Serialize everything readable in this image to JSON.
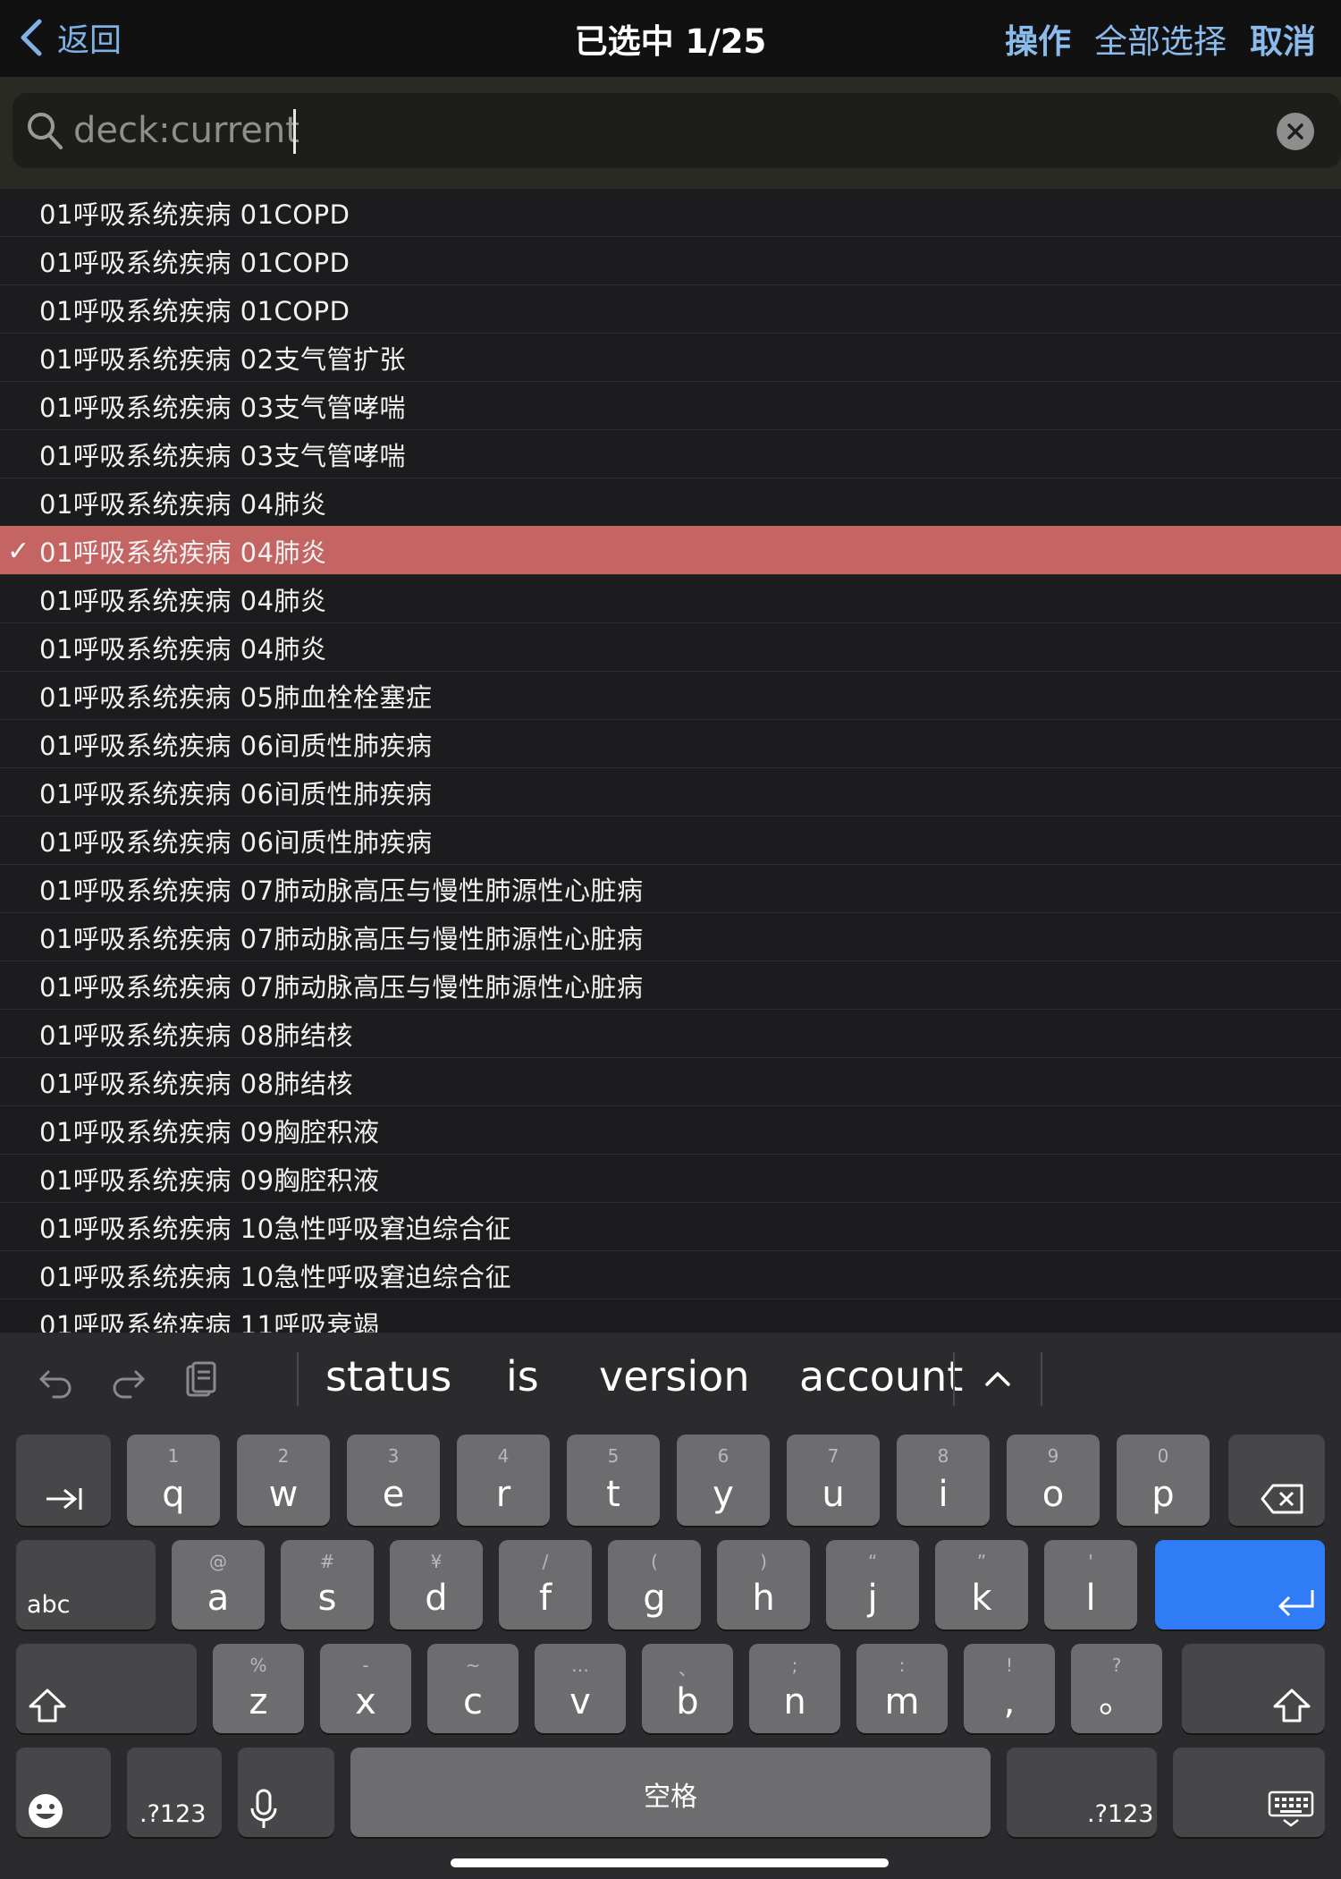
{
  "nav": {
    "back_label": "返回",
    "title": "已选中 1/25",
    "actions_label": "操作",
    "select_all_label": "全部选择",
    "cancel_label": "取消"
  },
  "search": {
    "value": "deck:current"
  },
  "list": {
    "rows": [
      {
        "text": "01呼吸系统疾病 01COPD",
        "selected": false
      },
      {
        "text": "01呼吸系统疾病 01COPD",
        "selected": false
      },
      {
        "text": "01呼吸系统疾病 01COPD",
        "selected": false
      },
      {
        "text": "01呼吸系统疾病 02支气管扩张",
        "selected": false
      },
      {
        "text": "01呼吸系统疾病 03支气管哮喘",
        "selected": false
      },
      {
        "text": "01呼吸系统疾病 03支气管哮喘",
        "selected": false
      },
      {
        "text": "01呼吸系统疾病 04肺炎",
        "selected": false
      },
      {
        "text": "01呼吸系统疾病 04肺炎",
        "selected": true
      },
      {
        "text": "01呼吸系统疾病 04肺炎",
        "selected": false
      },
      {
        "text": "01呼吸系统疾病 04肺炎",
        "selected": false
      },
      {
        "text": "01呼吸系统疾病 05肺血栓栓塞症",
        "selected": false
      },
      {
        "text": "01呼吸系统疾病 06间质性肺疾病",
        "selected": false
      },
      {
        "text": "01呼吸系统疾病 06间质性肺疾病",
        "selected": false
      },
      {
        "text": "01呼吸系统疾病 06间质性肺疾病",
        "selected": false
      },
      {
        "text": "01呼吸系统疾病 07肺动脉高压与慢性肺源性心脏病",
        "selected": false
      },
      {
        "text": "01呼吸系统疾病 07肺动脉高压与慢性肺源性心脏病",
        "selected": false
      },
      {
        "text": "01呼吸系统疾病 07肺动脉高压与慢性肺源性心脏病",
        "selected": false
      },
      {
        "text": "01呼吸系统疾病 08肺结核",
        "selected": false
      },
      {
        "text": "01呼吸系统疾病 08肺结核",
        "selected": false
      },
      {
        "text": "01呼吸系统疾病 09胸腔积液",
        "selected": false
      },
      {
        "text": "01呼吸系统疾病 09胸腔积液",
        "selected": false
      },
      {
        "text": "01呼吸系统疾病 10急性呼吸窘迫综合征",
        "selected": false
      },
      {
        "text": "01呼吸系统疾病 10急性呼吸窘迫综合征",
        "selected": false
      },
      {
        "text": "01呼吸系统疾病 11呼吸衰竭",
        "selected": false
      }
    ],
    "check_mark": "✓"
  },
  "keyboard": {
    "suggestions": [
      "status",
      "is",
      "version",
      "account"
    ],
    "row1": [
      {
        "sub": "1",
        "main": "q"
      },
      {
        "sub": "2",
        "main": "w"
      },
      {
        "sub": "3",
        "main": "e"
      },
      {
        "sub": "4",
        "main": "r"
      },
      {
        "sub": "5",
        "main": "t"
      },
      {
        "sub": "6",
        "main": "y"
      },
      {
        "sub": "7",
        "main": "u"
      },
      {
        "sub": "8",
        "main": "i"
      },
      {
        "sub": "9",
        "main": "o"
      },
      {
        "sub": "0",
        "main": "p"
      }
    ],
    "row2": [
      {
        "sub": "@",
        "main": "a"
      },
      {
        "sub": "#",
        "main": "s"
      },
      {
        "sub": "¥",
        "main": "d"
      },
      {
        "sub": "/",
        "main": "f"
      },
      {
        "sub": "(",
        "main": "g"
      },
      {
        "sub": ")",
        "main": "h"
      },
      {
        "sub": "“",
        "main": "j"
      },
      {
        "sub": "”",
        "main": "k"
      },
      {
        "sub": "'",
        "main": "l"
      }
    ],
    "row3": [
      {
        "sub": "%",
        "main": "z"
      },
      {
        "sub": "-",
        "main": "x"
      },
      {
        "sub": "~",
        "main": "c"
      },
      {
        "sub": "…",
        "main": "v"
      },
      {
        "sub": "、",
        "main": "b"
      },
      {
        "sub": ";",
        "main": "n"
      },
      {
        "sub": ":",
        "main": "m"
      },
      {
        "sub": "!",
        "main": ","
      },
      {
        "sub": "?",
        "main": "。"
      }
    ],
    "abc_label": "abc",
    "numbers_label": ".?123",
    "space_label": "空格"
  },
  "colors": {
    "accent": "#8bbbec",
    "selected_row": "#c46563",
    "return_key": "#2f7cf6"
  }
}
